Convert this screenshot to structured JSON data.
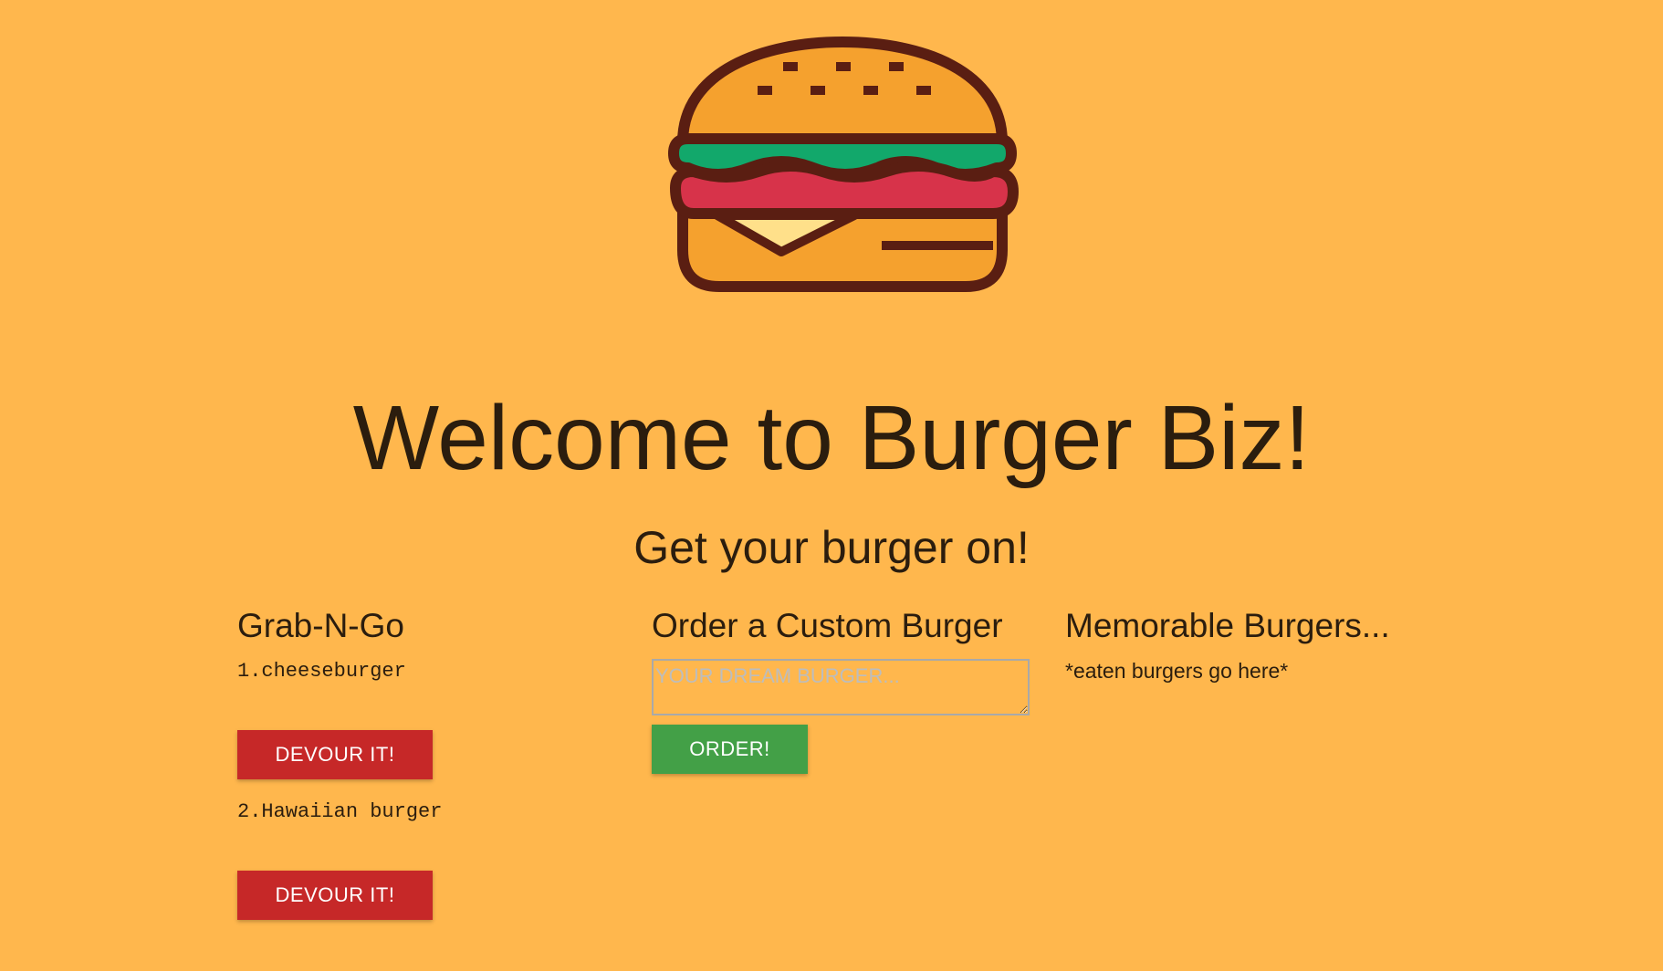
{
  "header": {
    "logo_icon": "burger-icon",
    "title": "Welcome to Burger Biz!",
    "subtitle": "Get your burger on!"
  },
  "grab_n_go": {
    "heading": "Grab-N-Go",
    "items": [
      {
        "label": "1.cheeseburger",
        "button_label": "DEVOUR IT!"
      },
      {
        "label": "2.Hawaiian burger",
        "button_label": "DEVOUR IT!"
      }
    ]
  },
  "custom_order": {
    "heading": "Order a Custom Burger",
    "input_placeholder": "YOUR DREAM BURGER...",
    "input_value": "",
    "button_label": "ORDER!"
  },
  "memorable": {
    "heading": "Memorable Burgers...",
    "note": "*eaten burgers go here*"
  },
  "colors": {
    "background": "#FFB74D",
    "devour_button": "#C62828",
    "order_button": "#43A047",
    "text": "#2b1d0e"
  }
}
